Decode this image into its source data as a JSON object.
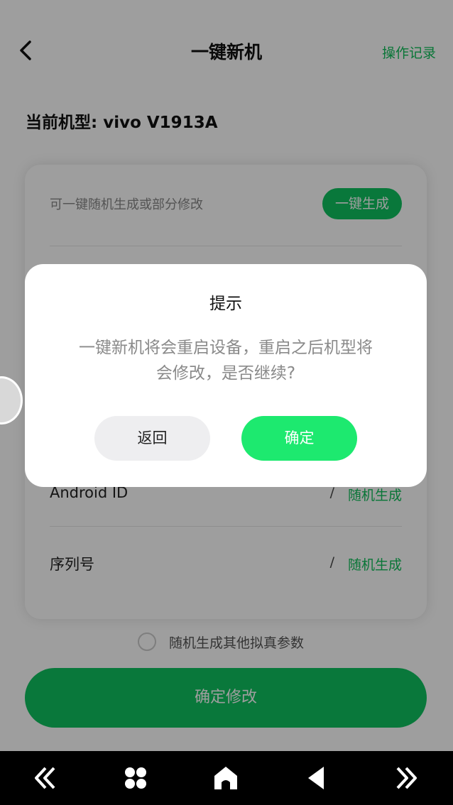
{
  "header": {
    "title": "一键新机",
    "record_label": "操作记录"
  },
  "model": {
    "label": "当前机型: vivo V1913A"
  },
  "card": {
    "hint": "可一键随机生成或部分修改",
    "generate_button": "一键生成",
    "rows": [
      {
        "label": "Android ID",
        "value": "/",
        "action": "随机生成"
      },
      {
        "label": "序列号",
        "value": "/",
        "action": "随机生成"
      }
    ]
  },
  "bottom": {
    "extra_option": "随机生成其他拟真参数",
    "confirm_button": "确定修改"
  },
  "dialog": {
    "title": "提示",
    "message_line1": "一键新机将会重启设备，重启之后机型将",
    "message_line2": "会修改，是否继续?",
    "cancel": "返回",
    "ok": "确定"
  },
  "colors": {
    "accent": "#10c25f",
    "dialog_ok": "#1de96f"
  }
}
